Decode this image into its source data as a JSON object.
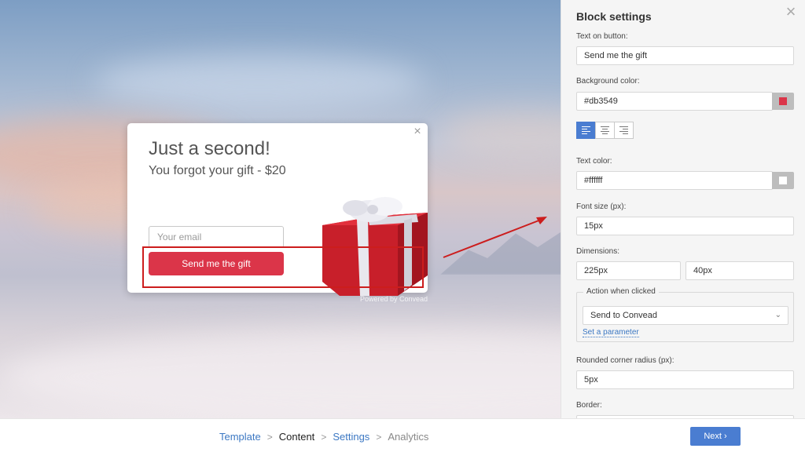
{
  "popup": {
    "title": "Just a second!",
    "subtitle": "You forgot your gift - $20",
    "email_placeholder": "Your email",
    "button_label": "Send me the gift",
    "powered_by": "Powered by Convead",
    "close_icon": "×",
    "button_color": "#db3549"
  },
  "panel": {
    "title": "Block settings",
    "close_icon": "×",
    "text_on_button_label": "Text on button:",
    "text_on_button_value": "Send me the gift",
    "bg_color_label": "Background color:",
    "bg_color_value": "#db3549",
    "alignment_buttons": [
      "align-left",
      "align-center",
      "align-right"
    ],
    "text_color_label": "Text color:",
    "text_color_value": "#ffffff",
    "font_size_label": "Font size (px):",
    "font_size_value": "15px",
    "dimensions_label": "Dimensions:",
    "width_value": "225px",
    "height_value": "40px",
    "action_legend": "Action when clicked",
    "action_value": "Send to Convead",
    "set_parameter": "Set a parameter",
    "radius_label": "Rounded corner radius (px):",
    "radius_value": "5px",
    "border_label": "Border:"
  },
  "wizard": {
    "steps": [
      {
        "label": "Template",
        "state": "done"
      },
      {
        "label": "Content",
        "state": "current"
      },
      {
        "label": "Settings",
        "state": "done"
      },
      {
        "label": "Analytics",
        "state": "future"
      }
    ],
    "separator": ">",
    "next_label": "Next ›"
  },
  "colors": {
    "accent": "#4a7dd1",
    "link": "#3c78c3",
    "highlight": "#cc1d1d"
  }
}
